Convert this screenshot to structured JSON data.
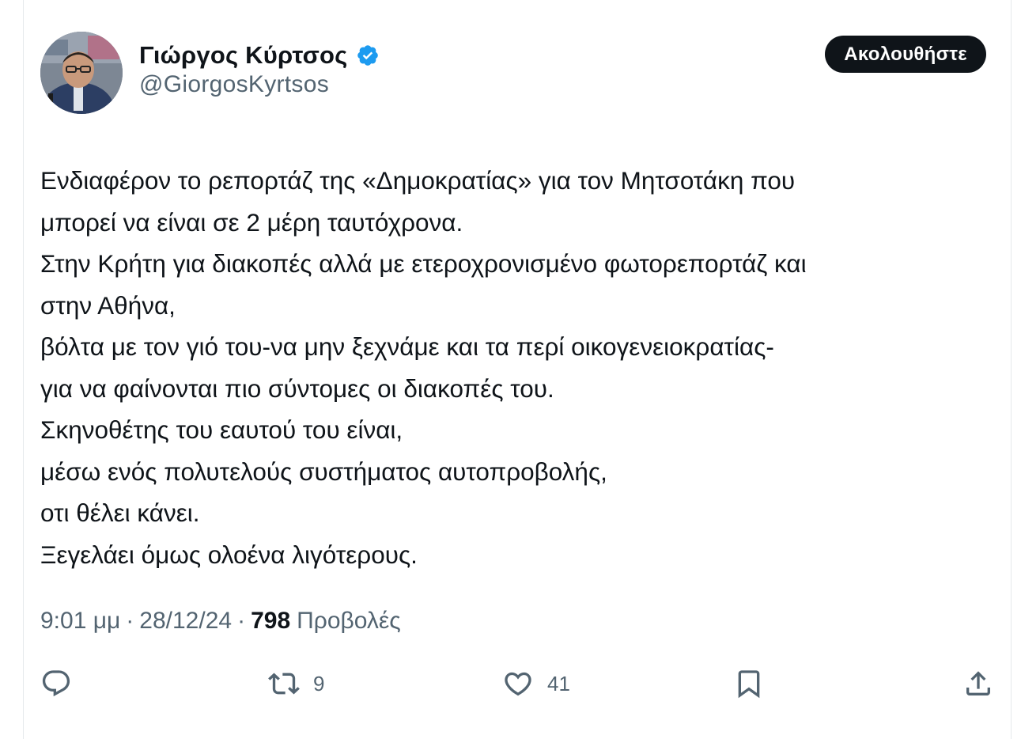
{
  "author": {
    "name": "Γιώργος Κύρτσος",
    "handle": "@GiorgosKyrtsos",
    "verified": true,
    "verified_color": "#1d9bf0"
  },
  "follow_button": {
    "label": "Ακολουθήστε",
    "bg_color": "#0f1419",
    "text_color": "#ffffff"
  },
  "tweet": {
    "lines": [
      "Ενδιαφέρον το ρεπορτάζ της «Δημοκρατίας» για τον Μητσοτάκη που",
      "μπορεί να είναι σε 2 μέρη ταυτόχρονα.",
      "Στην Κρήτη για διακοπές αλλά με ετεροχρονισμένο φωτορεπορτάζ και",
      "στην Αθήνα,",
      "βόλτα με τον γιό του-να μην ξεχνάμε και τα περί οικογενειοκρατίας-",
      "για να φαίνονται πιο σύντομες οι διακοπές του.",
      "Σκηνοθέτης του εαυτού του είναι,",
      "μέσω ενός πολυτελούς συστήματος αυτοπροβολής,",
      "οτι θέλει κάνει.",
      "Ξεγελάει όμως ολοένα λιγότερους."
    ]
  },
  "meta": {
    "time": "9:01 μμ",
    "separator": "·",
    "date": "28/12/24",
    "views_count": "798",
    "views_label": "Προβολές"
  },
  "actions": {
    "reply": {
      "icon": "reply-icon",
      "count": ""
    },
    "retweet": {
      "icon": "retweet-icon",
      "count": "9"
    },
    "like": {
      "icon": "heart-icon",
      "count": "41"
    },
    "bookmark": {
      "icon": "bookmark-icon",
      "count": ""
    },
    "share": {
      "icon": "share-icon",
      "count": ""
    }
  },
  "colors": {
    "text_primary": "#0f1419",
    "text_secondary": "#536471",
    "border": "#e6e9ec"
  }
}
